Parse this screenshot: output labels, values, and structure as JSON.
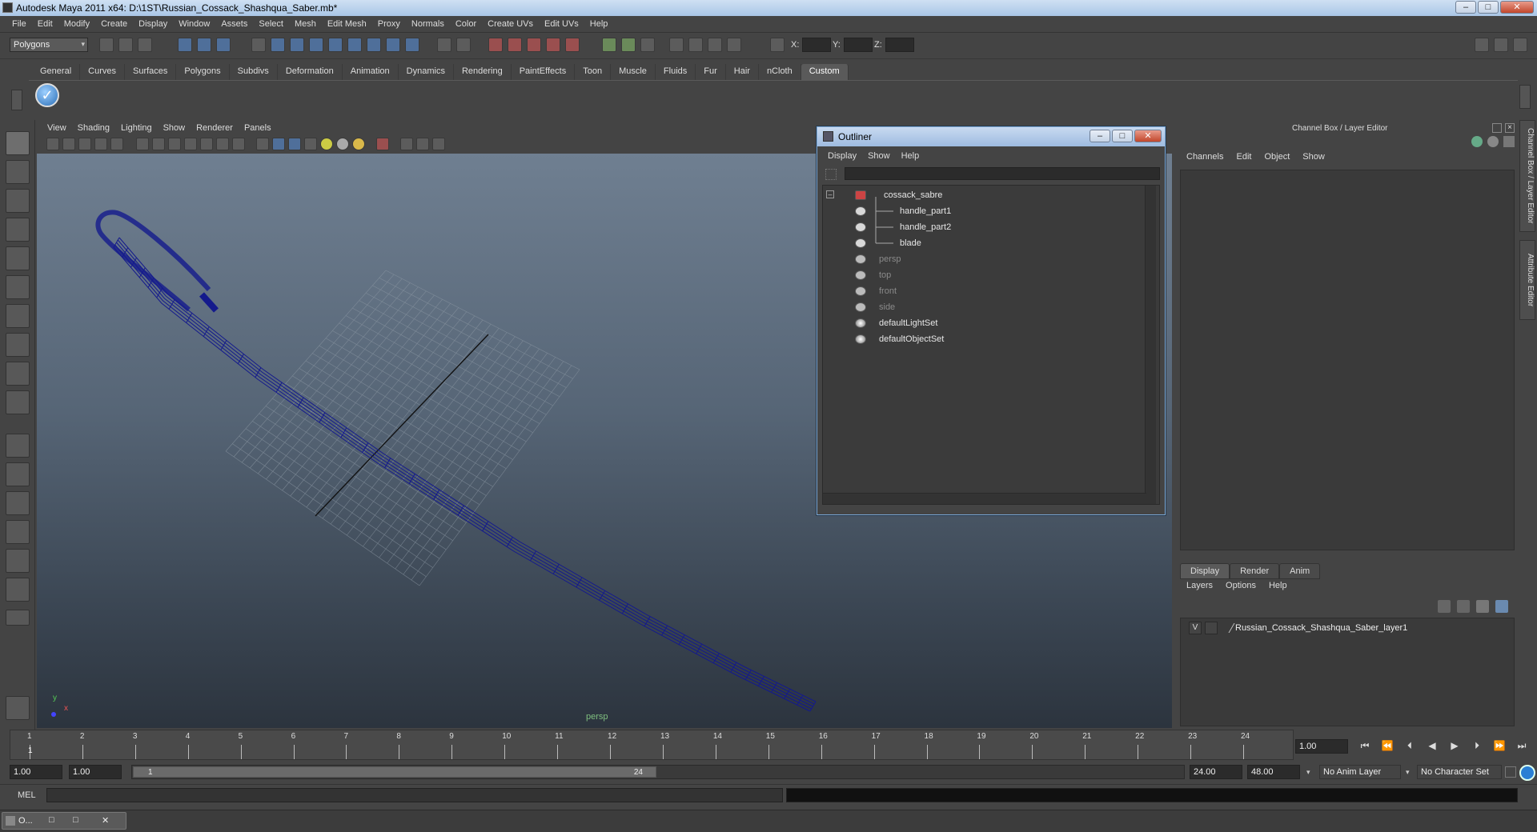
{
  "window": {
    "title": "Autodesk Maya 2011 x64: D:\\1ST\\Russian_Cossack_Shashqua_Saber.mb*",
    "buttons": [
      "–",
      "□",
      "✕"
    ]
  },
  "menubar": [
    "File",
    "Edit",
    "Modify",
    "Create",
    "Display",
    "Window",
    "Assets",
    "Select",
    "Mesh",
    "Edit Mesh",
    "Proxy",
    "Normals",
    "Color",
    "Create UVs",
    "Edit UVs",
    "Help"
  ],
  "statusline": {
    "mode": "Polygons",
    "x_label": "X:",
    "y_label": "Y:",
    "z_label": "Z:"
  },
  "shelf": {
    "tabs": [
      "General",
      "Curves",
      "Surfaces",
      "Polygons",
      "Subdivs",
      "Deformation",
      "Animation",
      "Dynamics",
      "Rendering",
      "PaintEffects",
      "Toon",
      "Muscle",
      "Fluids",
      "Fur",
      "Hair",
      "nCloth",
      "Custom"
    ],
    "active_tab": "Custom",
    "button_glyph": "✓"
  },
  "viewport": {
    "menu": [
      "View",
      "Shading",
      "Lighting",
      "Show",
      "Renderer",
      "Panels"
    ],
    "camera_label": "persp",
    "axis_y": "y",
    "axis_x": "x",
    "wire_color": "#141a8c"
  },
  "outliner": {
    "title": "Outliner",
    "menu": [
      "Display",
      "Show",
      "Help"
    ],
    "items": [
      {
        "label": "cossack_sabre",
        "dim": false
      },
      {
        "label": "handle_part1",
        "dim": false
      },
      {
        "label": "handle_part2",
        "dim": false
      },
      {
        "label": "blade",
        "dim": false
      },
      {
        "label": "persp",
        "dim": true
      },
      {
        "label": "top",
        "dim": true
      },
      {
        "label": "front",
        "dim": true
      },
      {
        "label": "side",
        "dim": true
      },
      {
        "label": "defaultLightSet",
        "dim": false
      },
      {
        "label": "defaultObjectSet",
        "dim": false
      }
    ]
  },
  "channelbox": {
    "header": "Channel Box / Layer Editor",
    "menu": [
      "Channels",
      "Edit",
      "Object",
      "Show"
    ],
    "side_tab_1": "Channel Box / Layer Editor",
    "side_tab_2": "Attribute Editor"
  },
  "layers": {
    "tabs": [
      "Display",
      "Render",
      "Anim"
    ],
    "active_tab": "Display",
    "menu": [
      "Layers",
      "Options",
      "Help"
    ],
    "layer_visible": "V",
    "layer_name": "Russian_Cossack_Shashqua_Saber_layer1"
  },
  "timeline": {
    "ticks": [
      "1",
      "2",
      "3",
      "4",
      "5",
      "6",
      "7",
      "8",
      "9",
      "10",
      "11",
      "12",
      "13",
      "14",
      "15",
      "16",
      "17",
      "18",
      "19",
      "20",
      "21",
      "22",
      "23",
      "24"
    ],
    "current_marker": "1",
    "current_frame": "1.00"
  },
  "range": {
    "start": "1.00",
    "playback_start": "1.00",
    "handle_start": "1",
    "handle_end": "24",
    "playback_end": "24.00",
    "end": "48.00",
    "anim_layer": "No Anim Layer",
    "character_set": "No Character Set"
  },
  "cmdline": {
    "label": "MEL"
  },
  "taskbar": {
    "item": "O..."
  }
}
